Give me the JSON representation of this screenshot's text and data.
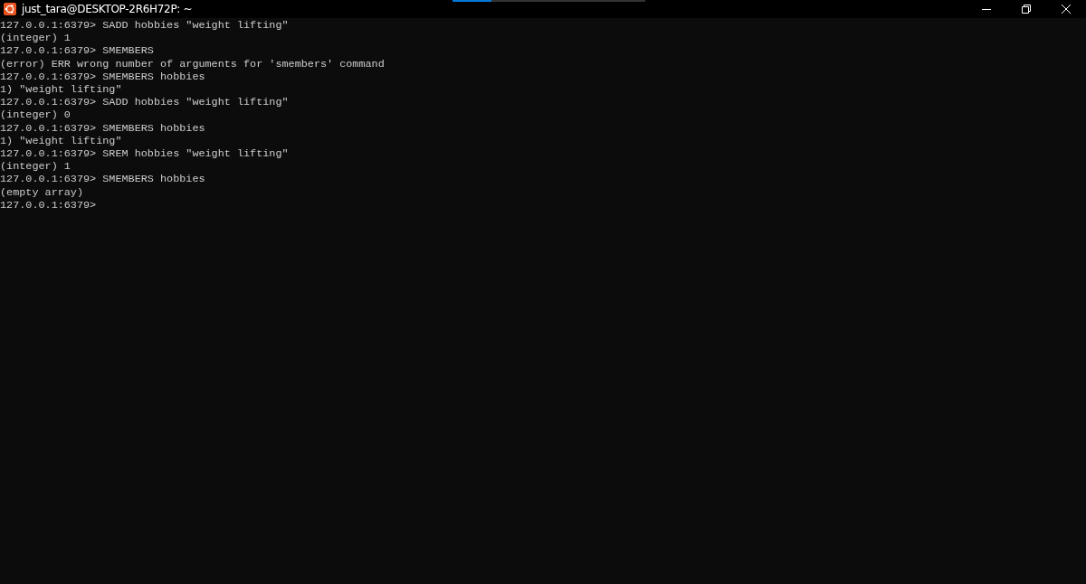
{
  "window": {
    "title": "just_tara@DESKTOP-2R6H72P: ~"
  },
  "terminal": {
    "lines": [
      "127.0.0.1:6379> SADD hobbies \"weight lifting\"",
      "(integer) 1",
      "127.0.0.1:6379> SMEMBERS",
      "(error) ERR wrong number of arguments for 'smembers' command",
      "127.0.0.1:6379> SMEMBERS hobbies",
      "1) \"weight lifting\"",
      "127.0.0.1:6379> SADD hobbies \"weight lifting\"",
      "(integer) 0",
      "127.0.0.1:6379> SMEMBERS hobbies",
      "1) \"weight lifting\"",
      "127.0.0.1:6379> SREM hobbies \"weight lifting\"",
      "(integer) 1",
      "127.0.0.1:6379> SMEMBERS hobbies",
      "(empty array)",
      "127.0.0.1:6379>"
    ]
  }
}
